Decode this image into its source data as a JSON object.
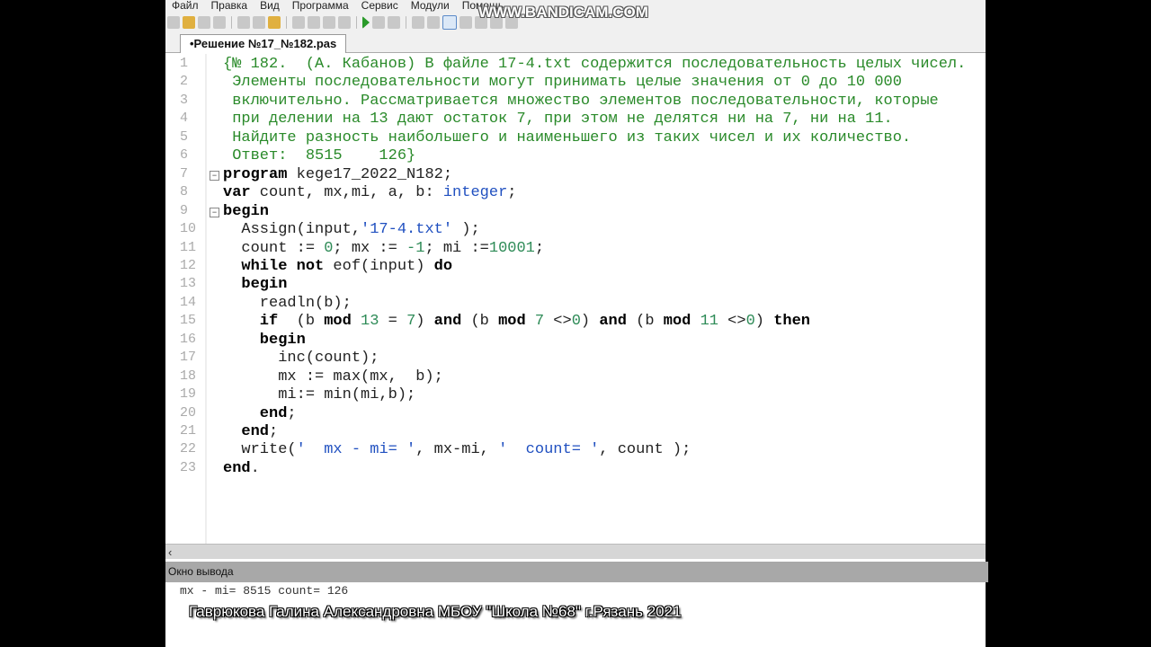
{
  "menu": [
    "Файл",
    "Правка",
    "Вид",
    "Программа",
    "Сервис",
    "Модули",
    "Помощь"
  ],
  "watermark": "WWW.BANDICAM.COM",
  "tab": {
    "label": "•Решение №17_№182.pas"
  },
  "code_lines": [
    [
      [
        "c",
        "{№ 182.  (А. Кабанов) В файле 17-4.txt содержится последовательность целых чисел."
      ]
    ],
    [
      [
        "c",
        " Элементы последовательности могут принимать целые значения от 0 до 10 000"
      ]
    ],
    [
      [
        "c",
        " включительно. Рассматривается множество элементов последовательности, которые"
      ]
    ],
    [
      [
        "c",
        " при делении на 13 дают остаток 7, при этом не делятся ни на 7, ни на 11."
      ]
    ],
    [
      [
        "c",
        " Найдите разность наибольшего и наименьшего из таких чисел и их количество."
      ]
    ],
    [
      [
        "c",
        " Ответ:  8515    126}"
      ]
    ],
    [
      [
        "k",
        "program"
      ],
      [
        "p",
        " kege17_2022_N182;"
      ]
    ],
    [
      [
        "k",
        "var"
      ],
      [
        "p",
        " count, mx,mi, a, b: "
      ],
      [
        "t",
        "integer"
      ],
      [
        "p",
        ";"
      ]
    ],
    [
      [
        "k",
        "begin"
      ]
    ],
    [
      [
        "p",
        "  Assign(input,"
      ],
      [
        "s",
        "'17-4.txt'"
      ],
      [
        "p",
        " );"
      ]
    ],
    [
      [
        "p",
        "  count := "
      ],
      [
        "n",
        "0"
      ],
      [
        "p",
        "; mx := "
      ],
      [
        "n",
        "-1"
      ],
      [
        "p",
        "; mi :="
      ],
      [
        "n",
        "10001"
      ],
      [
        "p",
        ";"
      ]
    ],
    [
      [
        "k",
        "  while not"
      ],
      [
        "p",
        " eof(input) "
      ],
      [
        "k",
        "do"
      ]
    ],
    [
      [
        "k",
        "  begin"
      ]
    ],
    [
      [
        "p",
        "    readln(b);"
      ]
    ],
    [
      [
        "k",
        "    if"
      ],
      [
        "p",
        "  (b "
      ],
      [
        "k",
        "mod"
      ],
      [
        "p",
        " "
      ],
      [
        "n",
        "13"
      ],
      [
        "p",
        " = "
      ],
      [
        "n",
        "7"
      ],
      [
        "p",
        ") "
      ],
      [
        "k",
        "and"
      ],
      [
        "p",
        " (b "
      ],
      [
        "k",
        "mod"
      ],
      [
        "p",
        " "
      ],
      [
        "n",
        "7"
      ],
      [
        "p",
        " <>"
      ],
      [
        "n",
        "0"
      ],
      [
        "p",
        ") "
      ],
      [
        "k",
        "and"
      ],
      [
        "p",
        " (b "
      ],
      [
        "k",
        "mod"
      ],
      [
        "p",
        " "
      ],
      [
        "n",
        "11"
      ],
      [
        "p",
        " <>"
      ],
      [
        "n",
        "0"
      ],
      [
        "p",
        ") "
      ],
      [
        "k",
        "then"
      ]
    ],
    [
      [
        "k",
        "    begin"
      ]
    ],
    [
      [
        "p",
        "      inc(count);"
      ]
    ],
    [
      [
        "p",
        "      mx := max(mx,  b);"
      ]
    ],
    [
      [
        "p",
        "      mi:= min(mi,b);"
      ]
    ],
    [
      [
        "k",
        "    end"
      ],
      [
        "p",
        ";"
      ]
    ],
    [
      [
        "k",
        "  end"
      ],
      [
        "p",
        ";"
      ]
    ],
    [
      [
        "p",
        "  write("
      ],
      [
        "s",
        "'  mx - mi= '"
      ],
      [
        "p",
        ", mx-mi, "
      ],
      [
        "s",
        "'  count= '"
      ],
      [
        "p",
        ", count );"
      ]
    ],
    [
      [
        "k",
        "end"
      ],
      [
        "p",
        "."
      ]
    ]
  ],
  "fold_lines": [
    7,
    9
  ],
  "output_window": {
    "title": "Окно вывода",
    "text": "mx - mi= 8515  count= 126"
  },
  "credit": "Гаврюкова Галина Александровна МБОУ \"Школа №68\" г.Рязань 2021"
}
